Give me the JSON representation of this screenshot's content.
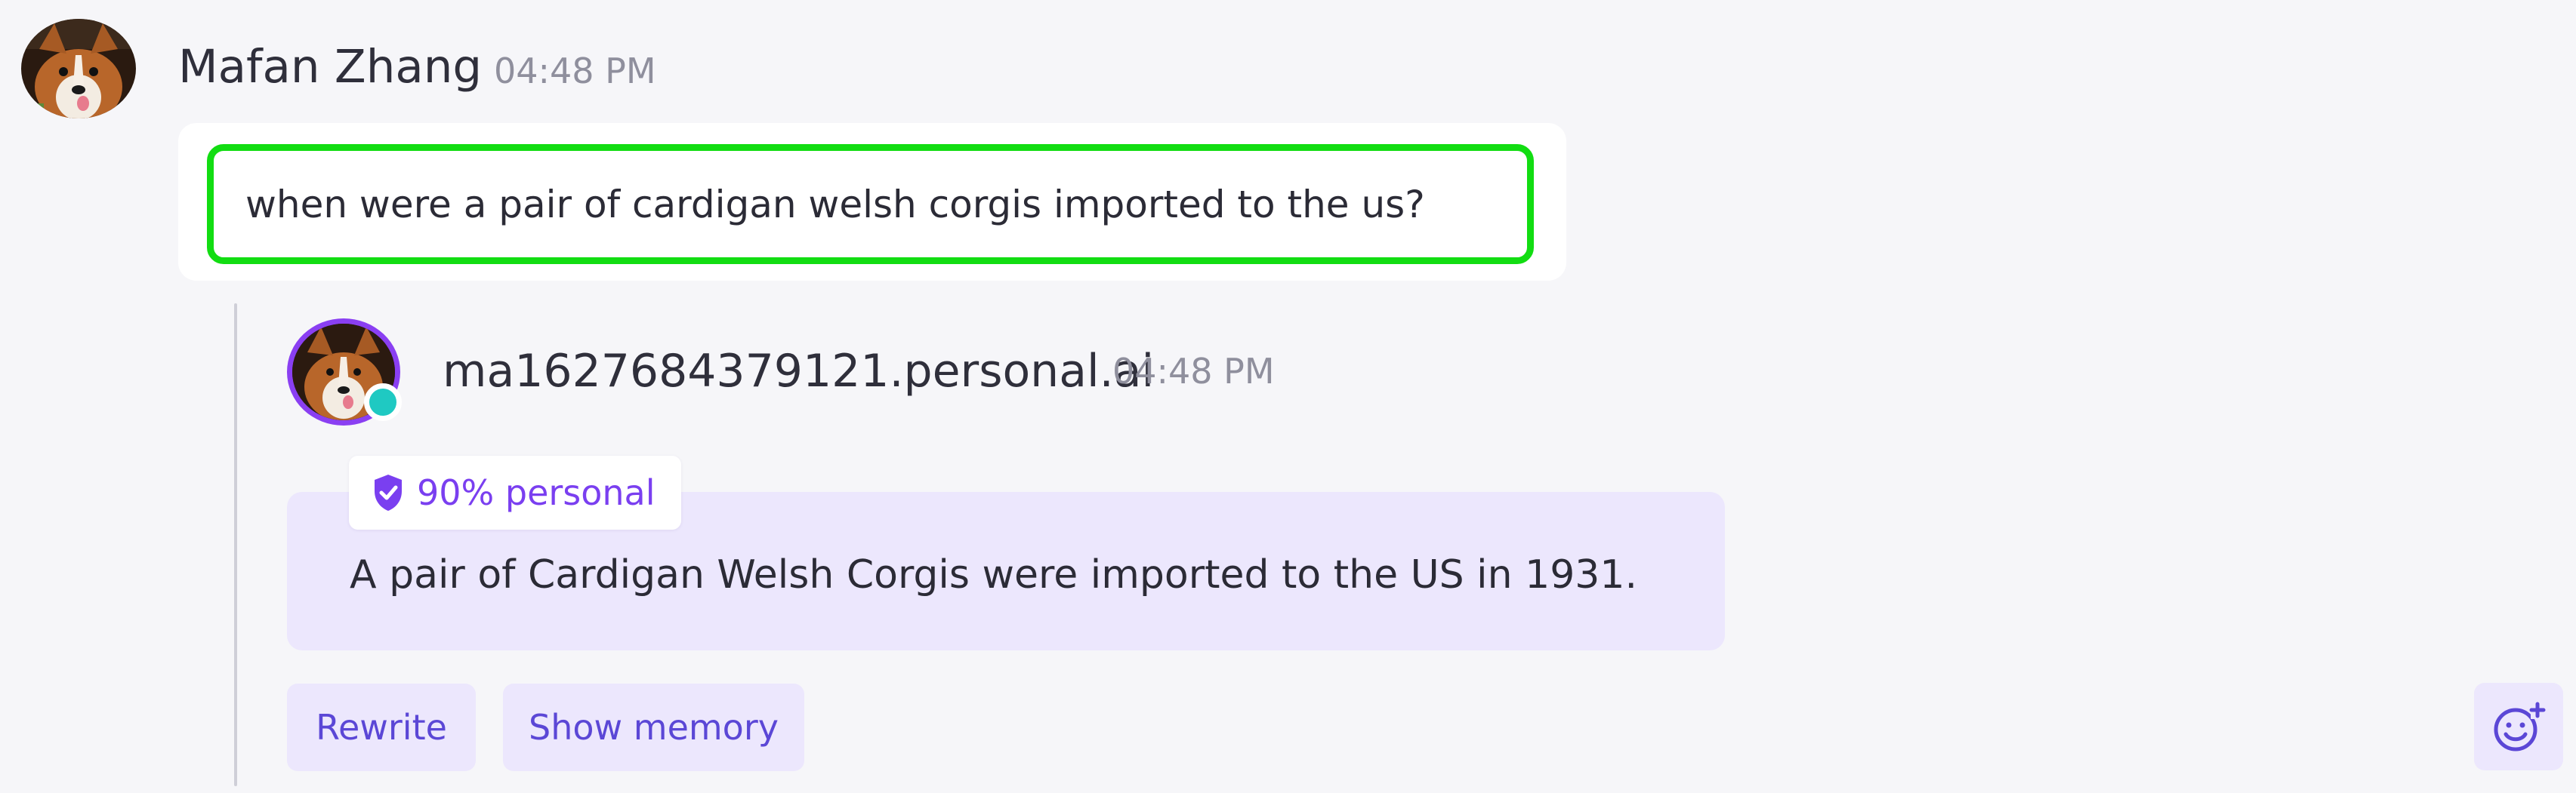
{
  "user_message": {
    "author": "Mafan Zhang",
    "time": "04:48 PM",
    "text": "when were a pair of cardigan welsh corgis imported to the us?",
    "avatar": "corgi-avatar"
  },
  "ai_reply": {
    "author": "ma1627684379121.personal.ai",
    "time": "04:48 PM",
    "avatar": "corgi-avatar",
    "online_status": "online",
    "personal_badge": "90% personal",
    "badge_icon": "shield-check-icon",
    "text": "A pair of Cardigan Welsh Corgis were imported to the US in 1931.",
    "actions": {
      "rewrite": "Rewrite",
      "show_memory": "Show memory"
    },
    "reaction_icon": "add-emoji-icon"
  },
  "colors": {
    "accent": "#7a3ff0",
    "highlight": "#12dd12",
    "answer_bg": "#ece7fd",
    "online": "#1fc9c2"
  }
}
